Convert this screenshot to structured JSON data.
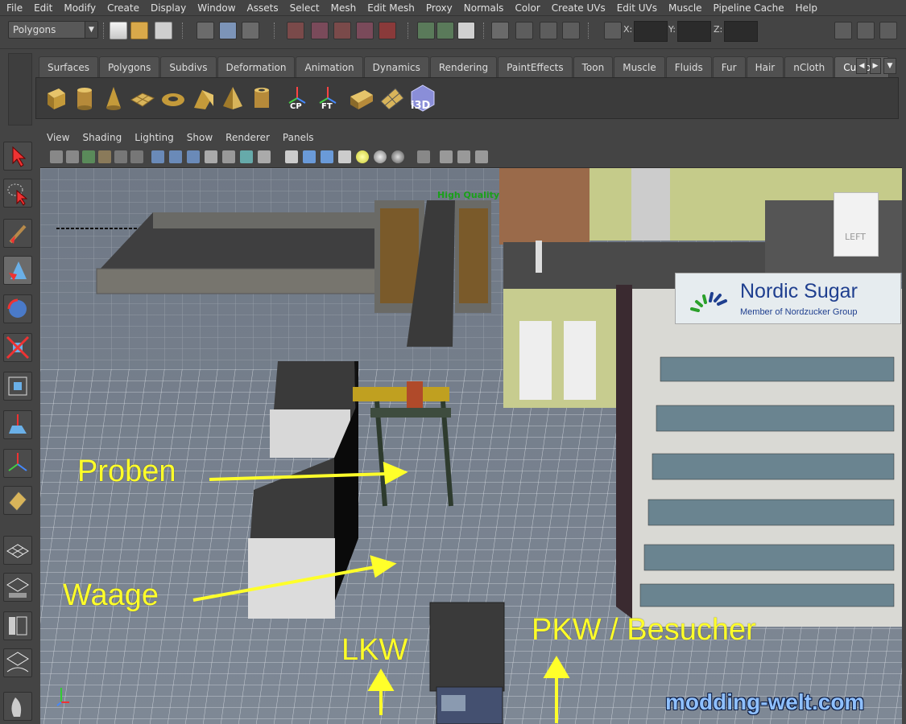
{
  "menu": [
    "File",
    "Edit",
    "Modify",
    "Create",
    "Display",
    "Window",
    "Assets",
    "Select",
    "Mesh",
    "Edit Mesh",
    "Proxy",
    "Normals",
    "Color",
    "Create UVs",
    "Edit UVs",
    "Muscle",
    "Pipeline Cache",
    "Help"
  ],
  "toolbar": {
    "mode": "Polygons",
    "x_label": "X:",
    "y_label": "Y:",
    "z_label": "Z:"
  },
  "shelf": {
    "tabs": [
      "Surfaces",
      "Polygons",
      "Subdivs",
      "Deformation",
      "Animation",
      "Dynamics",
      "Rendering",
      "PaintEffects",
      "Toon",
      "Muscle",
      "Fluids",
      "Fur",
      "Hair",
      "nCloth",
      "Custom"
    ],
    "active_tab": "Custom",
    "icons": [
      "cube-icon",
      "cylinder-icon",
      "cone-icon",
      "plane-icon",
      "torus-icon",
      "prism-icon",
      "pyramid-icon",
      "pipe-icon",
      "cp-pivot-icon",
      "ft-pivot-icon",
      "textured-box-icon",
      "uv-plane-icon",
      "i3d-icon"
    ],
    "cp_label": "CP",
    "ft_label": "FT",
    "i3d_label": "i3D"
  },
  "panel": {
    "menu": [
      "View",
      "Shading",
      "Lighting",
      "Show",
      "Renderer",
      "Panels"
    ]
  },
  "viewport": {
    "hq_label": "High Quality",
    "sign_name": "Nordic Sugar",
    "sign_sub": "Member of Nordzucker Group",
    "left_sign": "LEFT",
    "annotations": {
      "proben": "Proben",
      "waage": "Waage",
      "lkw": "LKW",
      "pkw": "PKW / Besucher"
    },
    "watermark": "modding-welt.com"
  },
  "colors": {
    "annotation": "#ffff2a",
    "grid": "#e6eaef",
    "ground": "#7d8794",
    "hq_text": "#1aa01a"
  }
}
